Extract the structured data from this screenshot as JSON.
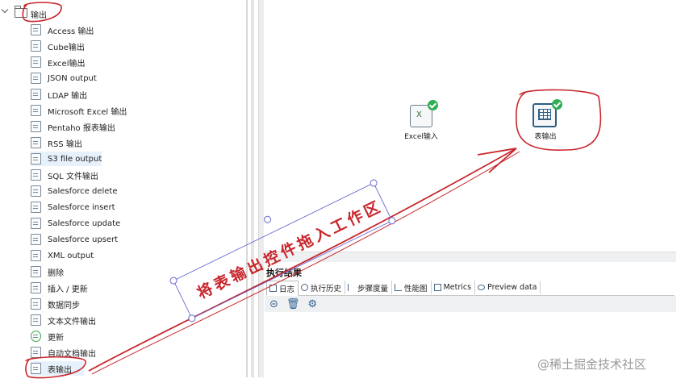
{
  "tree": {
    "root_label": "输出",
    "items": [
      {
        "label": "Access 输出",
        "icon": "access-output-icon"
      },
      {
        "label": "Cube输出",
        "icon": "cube-output-icon"
      },
      {
        "label": "Excel输出",
        "icon": "excel-output-icon"
      },
      {
        "label": "JSON output",
        "icon": "json-output-icon"
      },
      {
        "label": "LDAP 输出",
        "icon": "ldap-output-icon"
      },
      {
        "label": "Microsoft Excel 输出",
        "icon": "ms-excel-output-icon"
      },
      {
        "label": "Pentaho 报表输出",
        "icon": "pentaho-report-icon"
      },
      {
        "label": "RSS 输出",
        "icon": "rss-output-icon"
      },
      {
        "label": "S3 file output",
        "icon": "s3-output-icon"
      },
      {
        "label": "SQL 文件输出",
        "icon": "sql-file-output-icon"
      },
      {
        "label": "Salesforce delete",
        "icon": "salesforce-delete-icon"
      },
      {
        "label": "Salesforce insert",
        "icon": "salesforce-insert-icon"
      },
      {
        "label": "Salesforce update",
        "icon": "salesforce-update-icon"
      },
      {
        "label": "Salesforce upsert",
        "icon": "salesforce-upsert-icon"
      },
      {
        "label": "XML output",
        "icon": "xml-output-icon"
      },
      {
        "label": "删除",
        "icon": "delete-step-icon"
      },
      {
        "label": "插入 / 更新",
        "icon": "insert-update-icon"
      },
      {
        "label": "数据同步",
        "icon": "data-sync-icon"
      },
      {
        "label": "文本文件输出",
        "icon": "text-file-output-icon"
      },
      {
        "label": "更新",
        "icon": "update-icon"
      },
      {
        "label": "自动文档输出",
        "icon": "auto-doc-output-icon"
      },
      {
        "label": "表输出",
        "icon": "table-output-icon"
      }
    ]
  },
  "canvas": {
    "steps": [
      {
        "label": "Excel输入",
        "icon": "excel-input-icon",
        "status": "ok"
      },
      {
        "label": "表输出",
        "icon": "table-output-icon",
        "status": "ok"
      }
    ],
    "annotation_text": "将表输出控件拖入工作区"
  },
  "results": {
    "title": "执行结果",
    "tabs": [
      "日志",
      "执行历史",
      "步骤度量",
      "性能图",
      "Metrics",
      "Preview data"
    ],
    "tab_icons": [
      "log-icon",
      "history-icon",
      "step-metrics-icon",
      "performance-icon",
      "metrics-icon",
      "preview-icon"
    ],
    "toolbar": [
      "stop-icon",
      "trash-icon",
      "settings-icon"
    ]
  },
  "watermark": "@稀土掘金技术社区",
  "colors": {
    "annotation_red": "#c8262b",
    "check_green": "#2fae55",
    "selected_bg": "#e6f1fb"
  }
}
